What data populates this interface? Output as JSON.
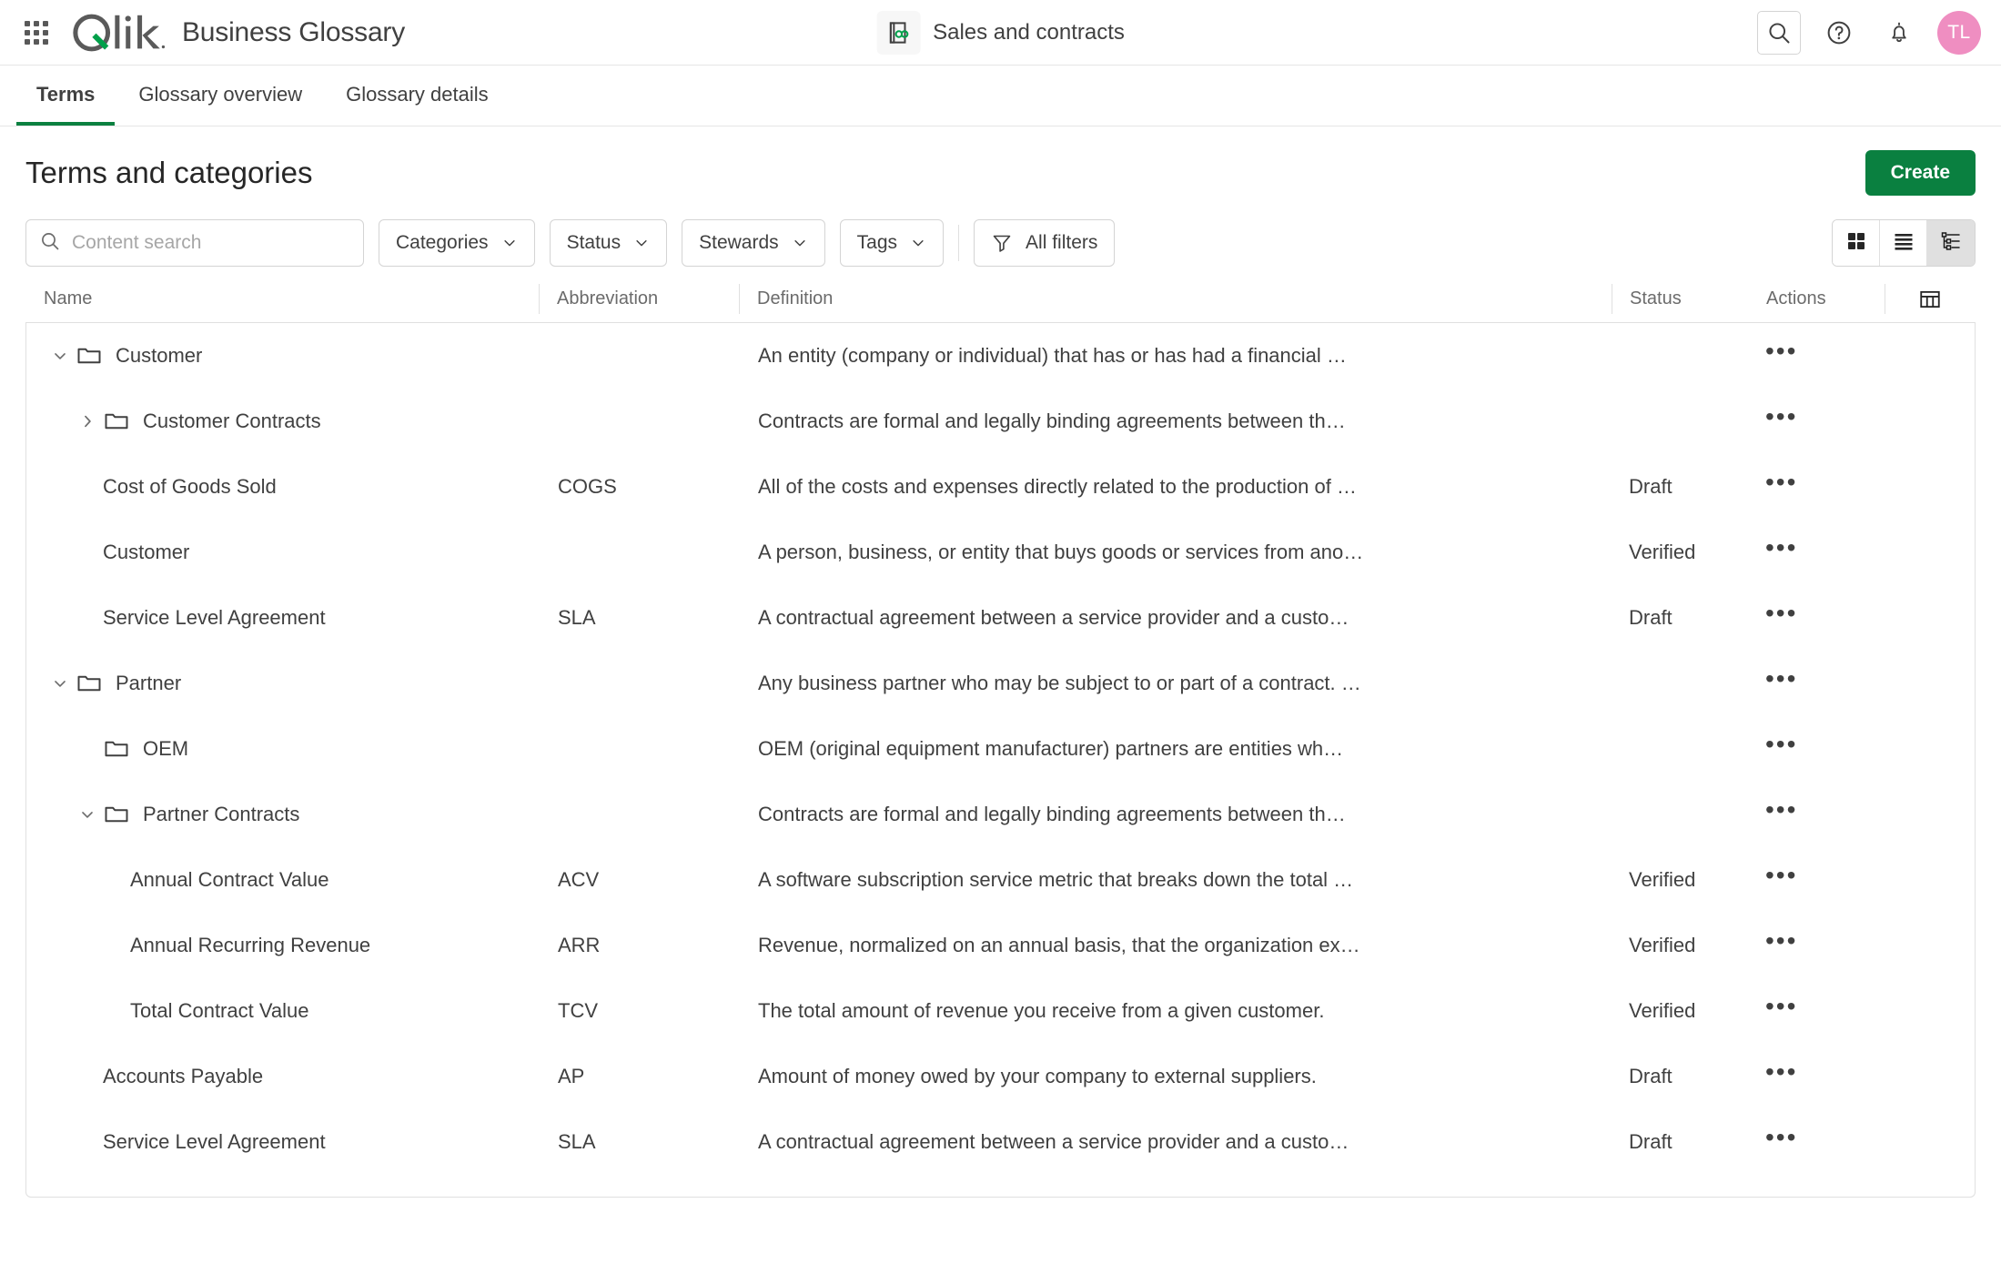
{
  "header": {
    "app_title": "Business Glossary",
    "waffle_icon": "app-launcher-icon",
    "logo_alt": "qlik-logo",
    "context": {
      "icon": "glossary-icon",
      "label": "Sales and contracts"
    },
    "search_icon": "search-icon",
    "help_icon": "help-circle-icon",
    "notifications_icon": "bell-icon",
    "avatar_initials": "TL"
  },
  "tabs": [
    {
      "label": "Terms",
      "active": true
    },
    {
      "label": "Glossary overview",
      "active": false
    },
    {
      "label": "Glossary details",
      "active": false
    }
  ],
  "page": {
    "title": "Terms and categories",
    "create_label": "Create"
  },
  "filters": {
    "search_placeholder": "Content search",
    "search_value": "",
    "search_icon": "search-icon",
    "chips": [
      {
        "label": "Categories",
        "icon": "chevron-down-icon"
      },
      {
        "label": "Status",
        "icon": "chevron-down-icon"
      },
      {
        "label": "Stewards",
        "icon": "chevron-down-icon"
      },
      {
        "label": "Tags",
        "icon": "chevron-down-icon"
      }
    ],
    "all_filters_label": "All filters",
    "all_filters_icon": "funnel-icon",
    "views": [
      {
        "name": "grid-view",
        "icon": "grid-icon",
        "active": false
      },
      {
        "name": "list-view",
        "icon": "list-icon",
        "active": false
      },
      {
        "name": "tree-view",
        "icon": "tree-icon",
        "active": true
      }
    ]
  },
  "table": {
    "columns": {
      "name": "Name",
      "abbreviation": "Abbreviation",
      "definition": "Definition",
      "status": "Status",
      "actions": "Actions",
      "settings_icon": "table-columns-icon"
    },
    "actions_glyph": "•••",
    "rows": [
      {
        "name": "Customer",
        "type": "folder",
        "level": 0,
        "twisty": "chevron-down-icon",
        "abbreviation": "",
        "definition": "An entity (company or individual) that has or has had a financial …",
        "status": ""
      },
      {
        "name": "Customer Contracts",
        "type": "folder",
        "level": 1,
        "twisty": "chevron-right-icon",
        "abbreviation": "",
        "definition": "Contracts are formal and legally binding agreements between th…",
        "status": ""
      },
      {
        "name": "Cost of Goods Sold",
        "type": "term",
        "level": 1,
        "twisty": "",
        "abbreviation": "COGS",
        "definition": "All of the costs and expenses directly related to the production of …",
        "status": "Draft"
      },
      {
        "name": "Customer",
        "type": "term",
        "level": 1,
        "twisty": "",
        "abbreviation": "",
        "definition": "A person, business, or entity that buys goods or services from ano…",
        "status": "Verified"
      },
      {
        "name": "Service Level Agreement",
        "type": "term",
        "level": 1,
        "twisty": "",
        "abbreviation": "SLA",
        "definition": "A contractual agreement between a service provider and a custo…",
        "status": "Draft"
      },
      {
        "name": "Partner",
        "type": "folder",
        "level": 0,
        "twisty": "chevron-down-icon",
        "abbreviation": "",
        "definition": "Any business partner who may be subject to or part of a contract. …",
        "status": ""
      },
      {
        "name": "OEM",
        "type": "folder",
        "level": 1,
        "twisty": "",
        "abbreviation": "",
        "definition": "OEM (original equipment manufacturer) partners are entities wh…",
        "status": ""
      },
      {
        "name": "Partner Contracts",
        "type": "folder",
        "level": 1,
        "twisty": "chevron-down-icon",
        "abbreviation": "",
        "definition": "Contracts are formal and legally binding agreements between th…",
        "status": ""
      },
      {
        "name": "Annual Contract Value",
        "type": "term",
        "level": 2,
        "twisty": "",
        "abbreviation": "ACV",
        "definition": "A software subscription service metric that breaks down the total …",
        "status": "Verified"
      },
      {
        "name": "Annual Recurring Revenue",
        "type": "term",
        "level": 2,
        "twisty": "",
        "abbreviation": "ARR",
        "definition": "Revenue, normalized on an annual basis, that the organization ex…",
        "status": "Verified"
      },
      {
        "name": "Total Contract Value",
        "type": "term",
        "level": 2,
        "twisty": "",
        "abbreviation": "TCV",
        "definition": "The total amount of revenue you receive from a given customer.",
        "status": "Verified"
      },
      {
        "name": "Accounts Payable",
        "type": "term",
        "level": 1,
        "twisty": "",
        "abbreviation": "AP",
        "definition": "Amount of money owed by your company to external suppliers.",
        "status": "Draft"
      },
      {
        "name": "Service Level Agreement",
        "type": "term",
        "level": 1,
        "twisty": "",
        "abbreviation": "SLA",
        "definition": "A contractual agreement between a service provider and a custo…",
        "status": "Draft"
      }
    ]
  },
  "colors": {
    "brand_green": "#0a8040",
    "logo_grey": "#5a5a5a",
    "logo_green": "#00A04A",
    "avatar_pink": "#ef8ec1",
    "border": "#e0e0e0",
    "text": "#404040"
  }
}
